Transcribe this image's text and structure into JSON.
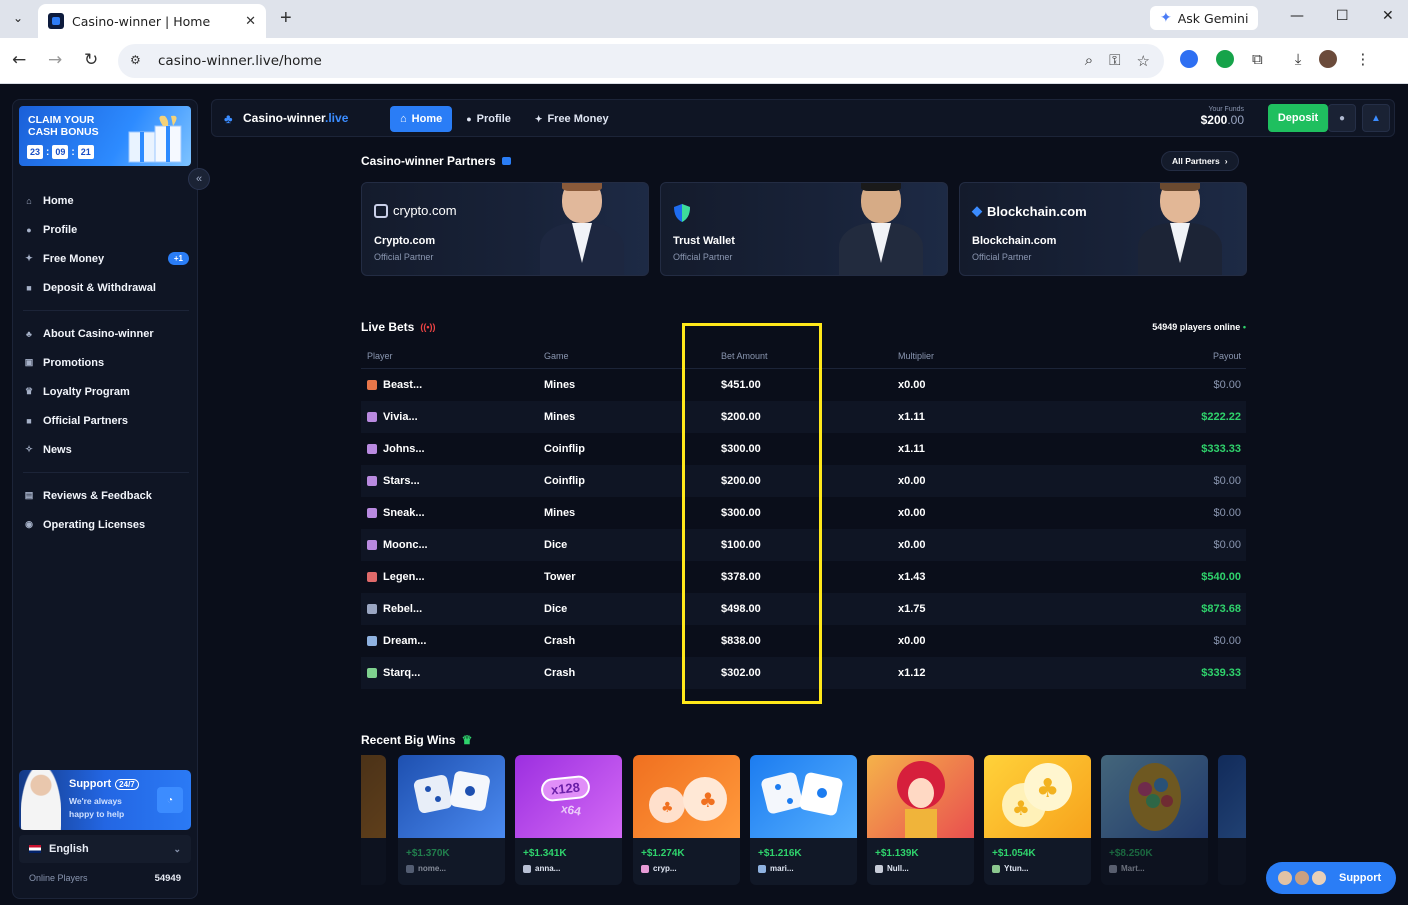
{
  "browser": {
    "tab_title": "Casino-winner | Home",
    "gemini_label": "Ask Gemini",
    "url": "casino-winner.live/home"
  },
  "sidebar": {
    "promo": {
      "title": "CLAIM YOUR CASH BONUS",
      "hours": "23",
      "minutes": "09",
      "seconds": "21"
    },
    "nav": [
      {
        "label": "Home",
        "icon": "home-icon"
      },
      {
        "label": "Profile",
        "icon": "user-icon"
      },
      {
        "label": "Free Money",
        "icon": "gift-icon",
        "badge": "+1"
      },
      {
        "label": "Deposit & Withdrawal",
        "icon": "wallet-icon"
      }
    ],
    "nav2": [
      {
        "label": "About Casino-winner",
        "icon": "clover-icon"
      },
      {
        "label": "Promotions",
        "icon": "megaphone-icon"
      },
      {
        "label": "Loyalty Program",
        "icon": "trophy-icon"
      },
      {
        "label": "Official Partners",
        "icon": "briefcase-icon"
      },
      {
        "label": "News",
        "icon": "news-icon"
      }
    ],
    "nav3": [
      {
        "label": "Reviews & Feedback",
        "icon": "chat-icon"
      },
      {
        "label": "Operating Licenses",
        "icon": "license-icon"
      }
    ],
    "support": {
      "title": "Support",
      "badge": "24/7",
      "subtitle": "We're always happy to help"
    },
    "language": "English",
    "online_label": "Online Players",
    "online_count": "54949"
  },
  "header": {
    "logo_main": "Casino-winner",
    "logo_accent": ".live",
    "nav": [
      "Home",
      "Profile",
      "Free Money"
    ],
    "funds_label": "Your Funds",
    "funds_main": "$200",
    "funds_cents": ".00",
    "deposit_label": "Deposit"
  },
  "partners": {
    "title": "Casino-winner Partners",
    "all_label": "All Partners",
    "items": [
      {
        "logo": "crypto.com",
        "name": "Crypto.com",
        "sub": "Official Partner"
      },
      {
        "logo": "",
        "name": "Trust Wallet",
        "sub": "Official Partner"
      },
      {
        "logo": "Blockchain.com",
        "name": "Blockchain.com",
        "sub": "Official Partner"
      }
    ]
  },
  "live_bets": {
    "title": "Live Bets",
    "players_online": "54949 players online",
    "columns": [
      "Player",
      "Game",
      "Bet Amount",
      "Multiplier",
      "Payout"
    ],
    "rows": [
      {
        "player": "Beast...",
        "game": "Mines",
        "bet": "$451.00",
        "mult": "x0.00",
        "payout": "$0.00",
        "win": false
      },
      {
        "player": "Vivia...",
        "game": "Mines",
        "bet": "$200.00",
        "mult": "x1.11",
        "payout": "$222.22",
        "win": true
      },
      {
        "player": "Johns...",
        "game": "Coinflip",
        "bet": "$300.00",
        "mult": "x1.11",
        "payout": "$333.33",
        "win": true
      },
      {
        "player": "Stars...",
        "game": "Coinflip",
        "bet": "$200.00",
        "mult": "x0.00",
        "payout": "$0.00",
        "win": false
      },
      {
        "player": "Sneak...",
        "game": "Mines",
        "bet": "$300.00",
        "mult": "x0.00",
        "payout": "$0.00",
        "win": false
      },
      {
        "player": "Moonc...",
        "game": "Dice",
        "bet": "$100.00",
        "mult": "x0.00",
        "payout": "$0.00",
        "win": false
      },
      {
        "player": "Legen...",
        "game": "Tower",
        "bet": "$378.00",
        "mult": "x1.43",
        "payout": "$540.00",
        "win": true
      },
      {
        "player": "Rebel...",
        "game": "Dice",
        "bet": "$498.00",
        "mult": "x1.75",
        "payout": "$873.68",
        "win": true
      },
      {
        "player": "Dream...",
        "game": "Crash",
        "bet": "$838.00",
        "mult": "x0.00",
        "payout": "$0.00",
        "win": false
      },
      {
        "player": "Starq...",
        "game": "Crash",
        "bet": "$302.00",
        "mult": "x1.12",
        "payout": "$339.33",
        "win": true
      }
    ]
  },
  "big_wins": {
    "title": "Recent Big Wins",
    "items": [
      {
        "amount": "+$1.370K",
        "user": "nome..."
      },
      {
        "amount": "+$1.341K",
        "user": "anna..."
      },
      {
        "amount": "+$1.274K",
        "user": "cryp..."
      },
      {
        "amount": "+$1.216K",
        "user": "mari..."
      },
      {
        "amount": "+$1.139K",
        "user": "Null..."
      },
      {
        "amount": "+$1.054K",
        "user": "Ytun..."
      },
      {
        "amount": "+$8.250K",
        "user": "Mart..."
      }
    ],
    "crash_labels": [
      "x128",
      "x64"
    ]
  },
  "support_pill": "Support",
  "colors": {
    "accent": "#2a7df6",
    "win": "#2fd36c",
    "deposit": "#1fbf5f",
    "highlight": "#ffe81a"
  }
}
